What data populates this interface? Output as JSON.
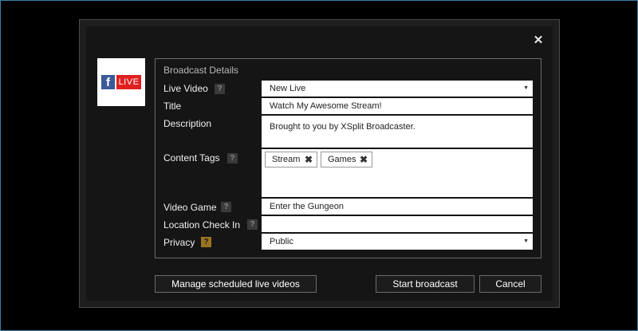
{
  "close_glyph": "✕",
  "logo": {
    "f": "f",
    "live": "LIVE"
  },
  "section_title": "Broadcast Details",
  "fields": {
    "live_video": {
      "label": "Live Video",
      "value": "New Live"
    },
    "title": {
      "label": "Title",
      "value": "Watch My Awesome Stream!"
    },
    "description": {
      "label": "Description",
      "value": "Brought to you by XSplit Broadcaster."
    },
    "content_tags": {
      "label": "Content Tags",
      "tags": [
        "Stream",
        "Games"
      ]
    },
    "video_game": {
      "label": "Video Game",
      "value": "Enter the Gungeon"
    },
    "location": {
      "label": "Location Check In",
      "value": ""
    },
    "privacy": {
      "label": "Privacy",
      "value": "Public"
    }
  },
  "help_glyph": "?",
  "remove_glyph": "✖",
  "dropdown_glyph": "▼",
  "buttons": {
    "manage": "Manage scheduled live videos",
    "start": "Start broadcast",
    "cancel": "Cancel"
  },
  "colors": {
    "facebook_blue": "#3b5998",
    "live_red": "#e02020",
    "help_warning": "#9a7420",
    "window_border": "#3a7fa8"
  }
}
